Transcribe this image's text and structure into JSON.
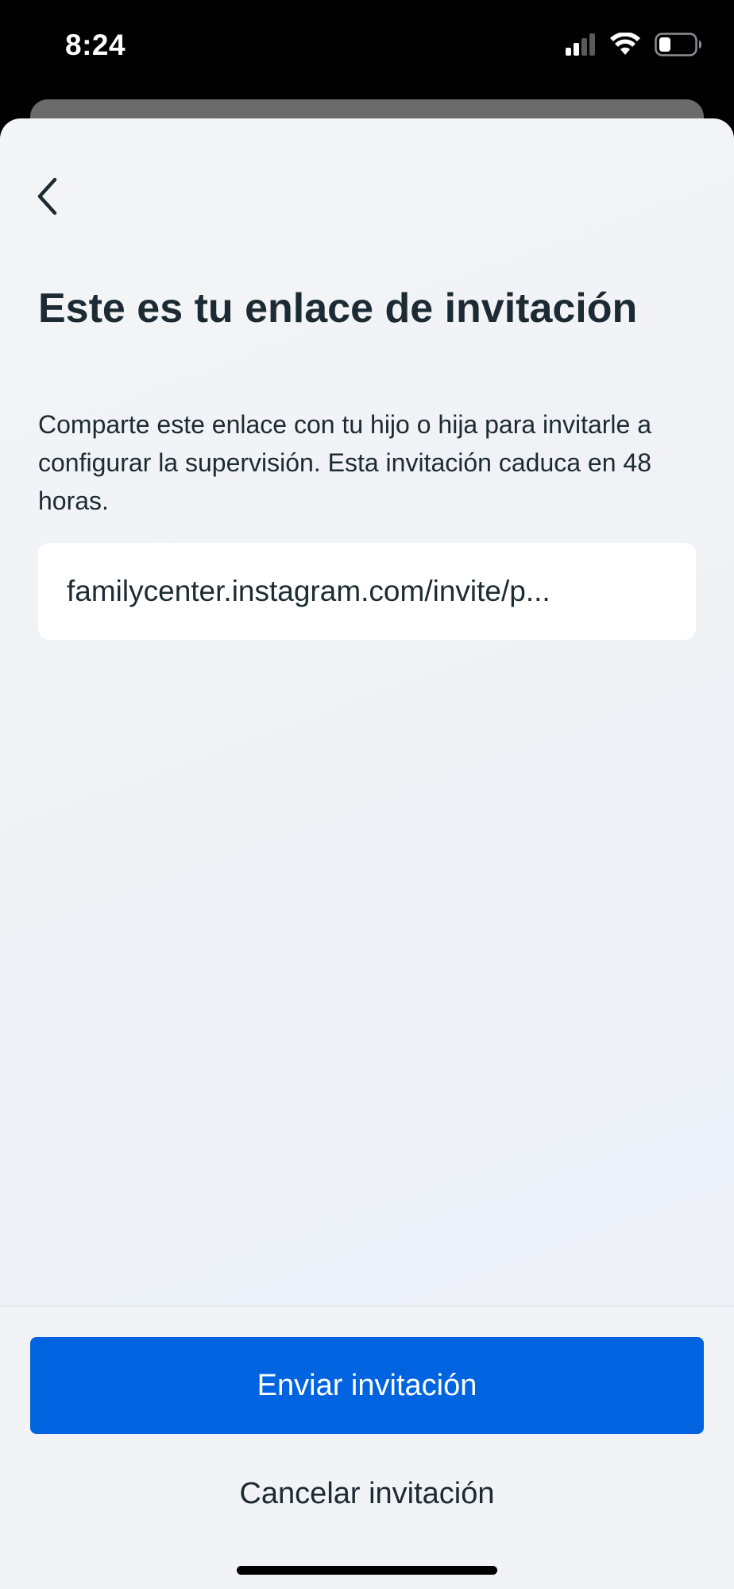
{
  "status_bar": {
    "time": "8:24",
    "icons": [
      "cellular-signal-icon",
      "wifi-icon",
      "battery-icon"
    ]
  },
  "header": {
    "back_icon": "chevron-left-icon"
  },
  "main": {
    "title": "Este es tu enlace de invitación",
    "description": "Comparte este enlace con tu hijo o hija para invitarle a configurar la supervisión. Esta invitación caduca en 48 horas.",
    "invite_link": "familycenter.instagram.com/invite/p..."
  },
  "actions": {
    "send_label": "Enviar invitación",
    "cancel_label": "Cancelar invitación"
  },
  "colors": {
    "primary_button": "#0064e0",
    "text": "#1c2b33"
  }
}
